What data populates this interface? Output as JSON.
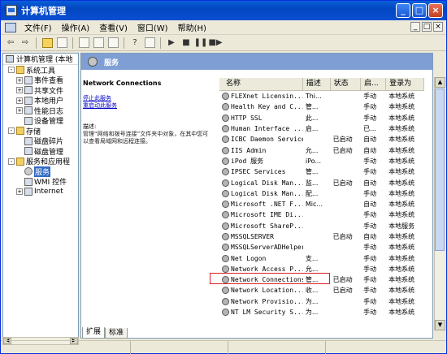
{
  "window": {
    "title": "计算机管理",
    "buttons": [
      "_",
      "□",
      "×"
    ]
  },
  "menu": [
    "文件(F)",
    "操作(A)",
    "查看(V)",
    "窗口(W)",
    "帮助(H)"
  ],
  "mdi_buttons": [
    "_",
    "□",
    "×"
  ],
  "toolbar_icons": [
    "back-icon",
    "forward-icon",
    "up-folder-icon",
    "show-hide-tree-icon",
    "properties-icon",
    "export-list-icon",
    "help-icon",
    "console-icon",
    "play-icon",
    "stop-icon",
    "pause-icon",
    "restart-icon"
  ],
  "tree": {
    "root": "计算机管理 (本地",
    "items": [
      {
        "label": "系统工具",
        "level": 1,
        "pm": "-"
      },
      {
        "label": "事件查看",
        "level": 2,
        "pm": "+"
      },
      {
        "label": "共享文件",
        "level": 2,
        "pm": "+"
      },
      {
        "label": "本地用户",
        "level": 2,
        "pm": "+"
      },
      {
        "label": "性能日志",
        "level": 2,
        "pm": "+"
      },
      {
        "label": "设备管理",
        "level": 2,
        "pm": ""
      },
      {
        "label": "存储",
        "level": 1,
        "pm": "-"
      },
      {
        "label": "磁盘碎片",
        "level": 2,
        "pm": ""
      },
      {
        "label": "磁盘管理",
        "level": 2,
        "pm": ""
      },
      {
        "label": "服务和应用程",
        "level": 1,
        "pm": "-"
      },
      {
        "label": "服务",
        "level": 2,
        "pm": "",
        "selected": true
      },
      {
        "label": "WMI 控件",
        "level": 2,
        "pm": ""
      },
      {
        "label": "Internet",
        "level": 2,
        "pm": "+"
      }
    ]
  },
  "panel": {
    "header": "服务"
  },
  "description": {
    "title": "Network Connections",
    "links": [
      "停止此服务",
      "重启动此服务"
    ],
    "label": "描述:",
    "text": "管理“网络和拨号连接”文件夹中对象，在其中您可以查看局域网和远程连接。"
  },
  "columns": [
    "名称",
    "描述",
    "状态",
    "启...",
    "登录为"
  ],
  "rows": [
    [
      "FLEXnet Licensin...",
      "Thi...",
      "",
      "手动",
      "本地系统"
    ],
    [
      "Health Key and C...",
      "管...",
      "",
      "手动",
      "本地系统"
    ],
    [
      "HTTP SSL",
      "此...",
      "",
      "手动",
      "本地系统"
    ],
    [
      "Human Interface ...",
      "启...",
      "",
      "已...",
      "本地系统"
    ],
    [
      "ICBC Daemon Service",
      "",
      "已启动",
      "自动",
      "本地系统"
    ],
    [
      "IIS Admin",
      "允...",
      "已启动",
      "自动",
      "本地系统"
    ],
    [
      "iPod 服务",
      "iPo...",
      "",
      "手动",
      "本地系统"
    ],
    [
      "IPSEC Services",
      "管...",
      "",
      "手动",
      "本地系统"
    ],
    [
      "Logical Disk Man...",
      "监...",
      "已启动",
      "自动",
      "本地系统"
    ],
    [
      "Logical Disk Man...",
      "配...",
      "",
      "手动",
      "本地系统"
    ],
    [
      "Microsoft .NET F...",
      "Mic...",
      "",
      "自动",
      "本地系统"
    ],
    [
      "Microsoft IME Di...",
      "",
      "",
      "手动",
      "本地系统"
    ],
    [
      "Microsoft ShareP...",
      "",
      "",
      "手动",
      "本地服务"
    ],
    [
      "MSSQLSERVER",
      "",
      "已启动",
      "自动",
      "本地系统"
    ],
    [
      "MSSQLServerADHelper",
      "",
      "",
      "手动",
      "本地系统"
    ],
    [
      "Net Logon",
      "支...",
      "",
      "手动",
      "本地系统"
    ],
    [
      "Network Access P...",
      "允...",
      "",
      "手动",
      "本地系统"
    ],
    [
      "Network Connections",
      "管...",
      "已启动",
      "手动",
      "本地系统"
    ],
    [
      "Network Location...",
      "收...",
      "已启动",
      "手动",
      "本地系统"
    ],
    [
      "Network Provisio...",
      "为...",
      "",
      "手动",
      "本地系统"
    ],
    [
      "NT LM Security S...",
      "为...",
      "",
      "手动",
      "本地系统"
    ]
  ],
  "highlight_row": "Network Connections",
  "tabs": [
    "扩展",
    "标准"
  ]
}
